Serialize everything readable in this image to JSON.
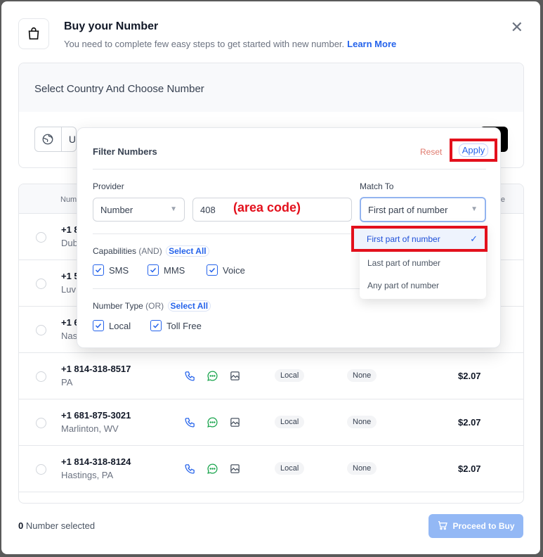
{
  "header": {
    "title": "Buy your Number",
    "subtitle": "You need to complete few easy steps to get started with new number.",
    "learn_more": "Learn More",
    "close": "✕"
  },
  "section": {
    "title": "Select Country And Choose Number",
    "country_value": "U"
  },
  "table": {
    "col_number": "Num",
    "col_price": "e",
    "rows": [
      {
        "number": "+1 8",
        "location": "Dub"
      },
      {
        "number": "+1 5",
        "location": "Luv"
      },
      {
        "number": "+1 6",
        "location": "Nas"
      },
      {
        "number": "+1 814-318-8517",
        "location": "PA",
        "type": "Local",
        "address": "None",
        "price": "$2.07"
      },
      {
        "number": "+1 681-875-3021",
        "location": "Marlinton, WV",
        "type": "Local",
        "address": "None",
        "price": "$2.07"
      },
      {
        "number": "+1 814-318-8124",
        "location": "Hastings, PA",
        "type": "Local",
        "address": "None",
        "price": "$2.07"
      }
    ]
  },
  "footer": {
    "count": "0",
    "selected_label": "Number selected",
    "proceed": "Proceed to Buy"
  },
  "filter": {
    "title": "Filter Numbers",
    "reset": "Reset",
    "apply": "Apply",
    "provider_label": "Provider",
    "provider_value": "Number",
    "number_value": "408",
    "area_code_note": "(area code)",
    "match_label": "Match To",
    "match_value": "First part of number",
    "match_options": [
      "First part of number",
      "Last part of number",
      "Any part of number"
    ],
    "capabilities_label": "Capabilities",
    "capabilities_mode": "(AND)",
    "select_all": "Select All",
    "capabilities": [
      "SMS",
      "MMS",
      "Voice"
    ],
    "number_type_label": "Number Type",
    "number_type_mode": "(OR)",
    "number_types": [
      "Local",
      "Toll Free"
    ]
  },
  "colors": {
    "accent": "#2563eb",
    "highlight": "#e3101c",
    "proceed_disabled": "#93b8f5"
  }
}
